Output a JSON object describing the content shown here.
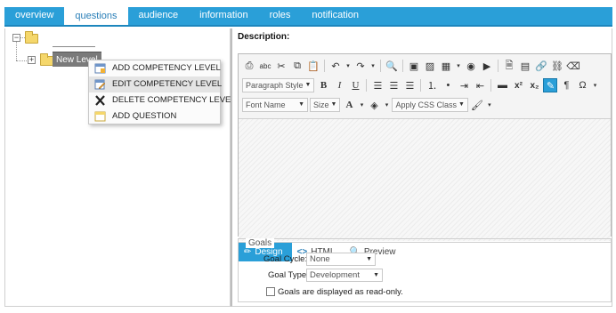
{
  "tabs": [
    {
      "label": "overview",
      "active": false
    },
    {
      "label": "questions",
      "active": true
    },
    {
      "label": "audience",
      "active": false
    },
    {
      "label": "information",
      "active": false
    },
    {
      "label": "roles",
      "active": false
    },
    {
      "label": "notification",
      "active": false
    }
  ],
  "tree": {
    "child_node_label": "New Level"
  },
  "context_menu": {
    "items": [
      {
        "label": "ADD COMPETENCY LEVEL",
        "icon": "add-level-icon",
        "highlighted": false
      },
      {
        "label": "EDIT COMPETENCY LEVEL",
        "icon": "edit-level-icon",
        "highlighted": true
      },
      {
        "label": "DELETE COMPETENCY LEVEL",
        "icon": "delete-x-icon",
        "highlighted": false
      },
      {
        "label": "ADD QUESTION",
        "icon": "add-question-icon",
        "highlighted": false
      }
    ]
  },
  "editor": {
    "label": "Description:",
    "paragraph_style": "Paragraph Style",
    "font_name": "Font Name",
    "size": "Size",
    "css_class": "Apply CSS Class",
    "modes": [
      {
        "label": "Design",
        "active": true
      },
      {
        "label": "HTML",
        "active": false
      },
      {
        "label": "Preview",
        "active": false
      }
    ]
  },
  "goals": {
    "legend": "Goals",
    "cycle_label": "Goal Cycle:",
    "cycle_value": "None",
    "type_label": "Goal Type:",
    "type_value": "Development",
    "readonly_label": "Goals are displayed as read-only.",
    "readonly_checked": false
  },
  "colors": {
    "accent": "#2a9fd8",
    "folder": "#f5d76b",
    "node_highlight": "#7a7a7a"
  }
}
